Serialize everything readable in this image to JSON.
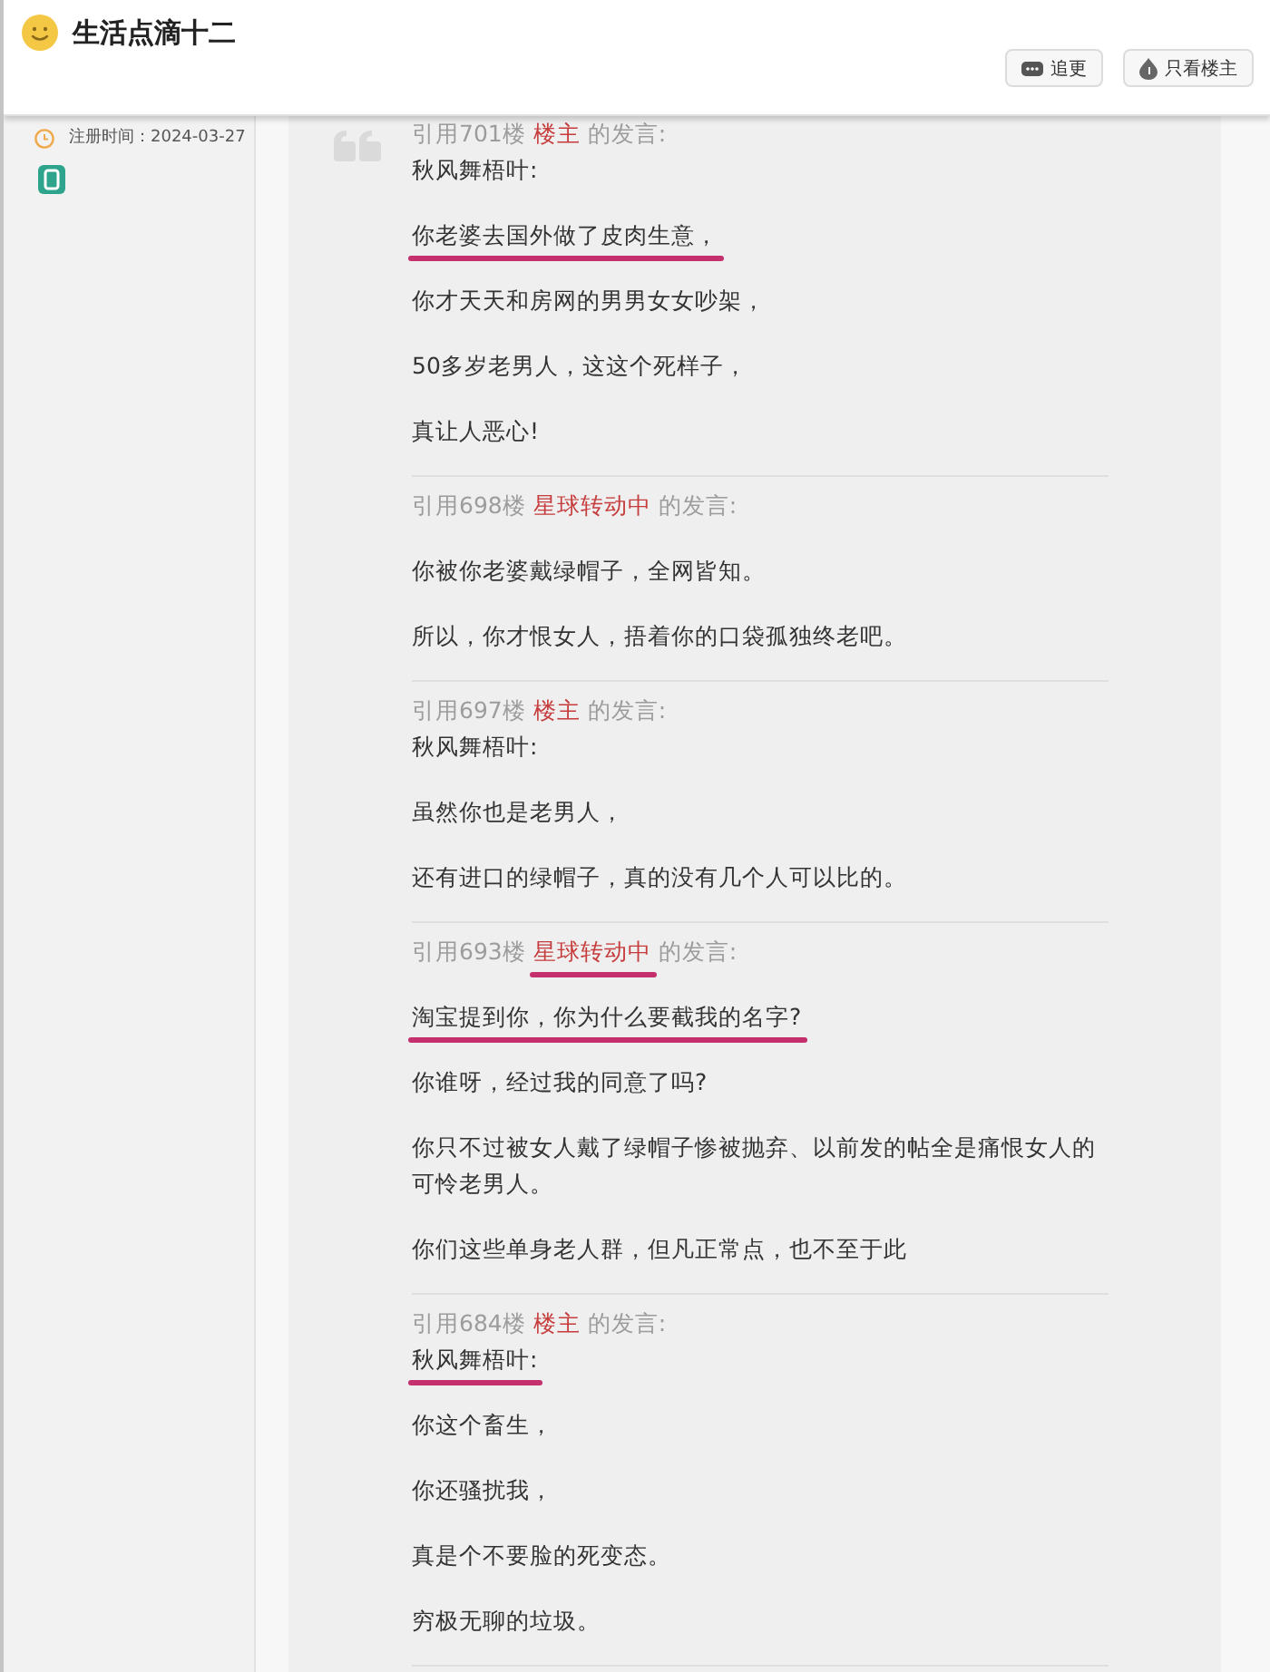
{
  "header": {
    "title": "生活点滴十二",
    "buttons": [
      {
        "kind": "follow",
        "label": "追更"
      },
      {
        "kind": "author_only",
        "label": "只看楼主"
      }
    ]
  },
  "sidebar": {
    "registered": "注册时间：2024-03-27"
  },
  "quotes": [
    {
      "floor": "引用701楼",
      "author": "楼主",
      "author_marked": false,
      "suffix": "的发言:",
      "addressee": {
        "text": "秋风舞梧叶:",
        "marked": false
      },
      "paragraphs": [
        {
          "text": "你老婆去国外做了皮肉生意，",
          "marked": true
        },
        {
          "text": "你才天天和房网的男男女女吵架，",
          "marked": false
        },
        {
          "text": "50多岁老男人，这这个死样子，",
          "marked": false
        },
        {
          "text": "真让人恶心!",
          "marked": false
        }
      ]
    },
    {
      "floor": "引用698楼",
      "author": "星球转动中",
      "author_marked": false,
      "suffix": "的发言:",
      "paragraphs": [
        {
          "text": "你被你老婆戴绿帽子，全网皆知。",
          "marked": false
        },
        {
          "text": "所以，你才恨女人，捂着你的口袋孤独终老吧。",
          "marked": false
        }
      ]
    },
    {
      "floor": "引用697楼",
      "author": "楼主",
      "author_marked": false,
      "suffix": "的发言:",
      "addressee": {
        "text": "秋风舞梧叶:",
        "marked": false
      },
      "paragraphs": [
        {
          "text": "虽然你也是老男人，",
          "marked": false
        },
        {
          "text": "还有进口的绿帽子，真的没有几个人可以比的。",
          "marked": false
        }
      ]
    },
    {
      "floor": "引用693楼",
      "author": "星球转动中",
      "author_marked": true,
      "suffix": "的发言:",
      "paragraphs": [
        {
          "text": "淘宝提到你，你为什么要截我的名字?",
          "marked": true
        },
        {
          "text": "你谁呀，经过我的同意了吗?",
          "marked": false
        },
        {
          "text": "你只不过被女人戴了绿帽子惨被抛弃、以前发的帖全是痛恨女人的可怜老男人。",
          "marked": false
        },
        {
          "text": "你们这些单身老人群，但凡正常点，也不至于此",
          "marked": false
        }
      ]
    },
    {
      "floor": "引用684楼",
      "author": "楼主",
      "author_marked": false,
      "suffix": "的发言:",
      "addressee": {
        "text": "秋风舞梧叶:",
        "marked": true
      },
      "paragraphs": [
        {
          "text": "你这个畜生，",
          "marked": false
        },
        {
          "text": "你还骚扰我，",
          "marked": false
        },
        {
          "text": "真是个不要脸的死变态。",
          "marked": false
        },
        {
          "text": "穷极无聊的垃圾。",
          "marked": false
        }
      ]
    }
  ]
}
